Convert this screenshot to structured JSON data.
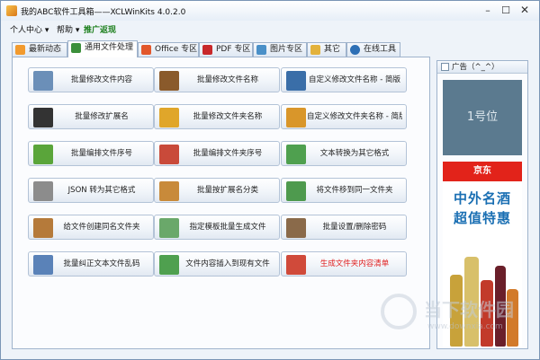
{
  "window": {
    "title": "我的ABC软件工具箱——XCLWinKits 4.0.2.0",
    "minimize_glyph": "–",
    "maximize_glyph": "☐",
    "close_glyph": "✕"
  },
  "menu": [
    {
      "label": "个人中心 ▾"
    },
    {
      "label": "帮助 ▾"
    },
    {
      "label": "推广返现"
    }
  ],
  "tabs": [
    {
      "label": "最新动态",
      "icon": "rss-icon",
      "color": "#f29a2e"
    },
    {
      "label": "通用文件处理",
      "icon": "document-icon",
      "color": "#3b8f3b",
      "active": true
    },
    {
      "label": "Office 专区",
      "icon": "office-icon",
      "color": "#e2572b"
    },
    {
      "label": "PDF 专区",
      "icon": "pdf-icon",
      "color": "#c8282a"
    },
    {
      "label": "图片专区",
      "icon": "image-icon",
      "color": "#4a90c8"
    },
    {
      "label": "其它",
      "icon": "folder-icon",
      "color": "#e3b23c"
    },
    {
      "label": "在线工具",
      "icon": "globe-icon",
      "color": "#2d6fb5"
    }
  ],
  "tools": [
    {
      "label": "批量修改文件内容",
      "icon": "file-edit-icon",
      "color": "#6b8fb8"
    },
    {
      "label": "批量修改文件名称",
      "icon": "ab-pencil-icon",
      "color": "#8a5a2b"
    },
    {
      "label": "自定义修改文件名称 - 简版",
      "icon": "letter-a-icon",
      "color": "#3a6ea8"
    },
    {
      "label": "批量修改扩展名",
      "icon": "ab-text-icon",
      "color": "#333333"
    },
    {
      "label": "批量修改文件夹名称",
      "icon": "folder-open-icon",
      "color": "#e0a62a"
    },
    {
      "label": "自定义修改文件夹名称 - 简版",
      "icon": "folder-gear-icon",
      "color": "#d9962a"
    },
    {
      "label": "批量编排文件序号",
      "icon": "bar-chart-icon",
      "color": "#5aa53a"
    },
    {
      "label": "批量编排文件夹序号",
      "icon": "bar-chart-color-icon",
      "color": "#c94a3a"
    },
    {
      "label": "文本转换为其它格式",
      "icon": "convert-icon",
      "color": "#4fa04f"
    },
    {
      "label": "JSON 转为其它格式",
      "icon": "json-convert-icon",
      "color": "#8c8c8c"
    },
    {
      "label": "批量按扩展名分类",
      "icon": "books-icon",
      "color": "#c88a3a"
    },
    {
      "label": "将文件移到同一文件夹",
      "icon": "merge-icon",
      "color": "#4e9a4e"
    },
    {
      "label": "给文件创建同名文件夹",
      "icon": "folder-create-icon",
      "color": "#b57a3a"
    },
    {
      "label": "指定模板批量生成文件",
      "icon": "template-icon",
      "color": "#6aa86a"
    },
    {
      "label": "批量设置/删除密码",
      "icon": "password-icon",
      "color": "#8a6a4a"
    },
    {
      "label": "批量纠正文本文件乱码",
      "icon": "text-fix-icon",
      "color": "#5a82b8"
    },
    {
      "label": "文件内容插入到现有文件",
      "icon": "insert-icon",
      "color": "#4fa04f"
    },
    {
      "label": "生成文件夹内容清单",
      "icon": "list-icon",
      "color": "#d04a3a",
      "red": true
    }
  ],
  "ad": {
    "header": "广告（^_^）",
    "slot_label": "1号位",
    "brand": "京东",
    "line1": "中外名酒",
    "line2": "超值特惠"
  },
  "watermark": {
    "text": "当下软件园",
    "url": "www.downxia.com"
  }
}
